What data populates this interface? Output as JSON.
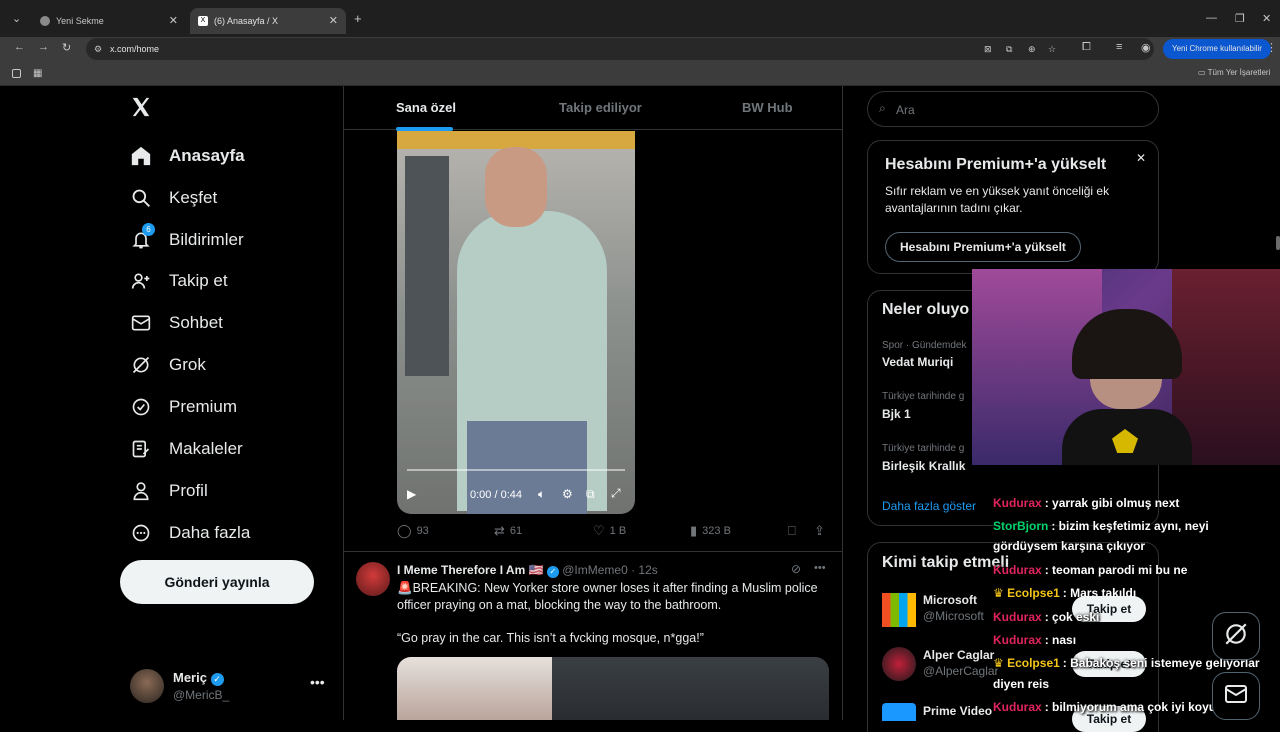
{
  "browser": {
    "tabs": [
      {
        "title": "Yeni Sekme"
      },
      {
        "title": "(6) Anasayfa / X"
      }
    ],
    "url": "x.com/home",
    "update_badge": "Yeni Chrome kullanılabilir",
    "bookmarks_all": "Tüm Yer İşaretleri"
  },
  "sidebar": {
    "items": [
      {
        "label": "Anasayfa",
        "icon": "home-icon"
      },
      {
        "label": "Keşfet",
        "icon": "search-icon"
      },
      {
        "label": "Bildirimler",
        "icon": "bell-icon",
        "badge": "6"
      },
      {
        "label": "Takip et",
        "icon": "follow-icon"
      },
      {
        "label": "Sohbet",
        "icon": "mail-icon"
      },
      {
        "label": "Grok",
        "icon": "grok-icon"
      },
      {
        "label": "Premium",
        "icon": "premium-icon"
      },
      {
        "label": "Makaleler",
        "icon": "articles-icon"
      },
      {
        "label": "Profil",
        "icon": "profile-icon"
      },
      {
        "label": "Daha fazla",
        "icon": "more-icon"
      }
    ],
    "post_button": "Gönderi yayınla",
    "account": {
      "name": "Meriç",
      "handle": "@MericB_"
    }
  },
  "feed": {
    "tabs": [
      "Sana özel",
      "Takip ediliyor",
      "BW Hub"
    ],
    "video": {
      "time": "0:00 / 0:44"
    },
    "stats": {
      "replies": "93",
      "reposts": "61",
      "likes": "1 B",
      "views": "323 B"
    },
    "post": {
      "author": "I Meme Therefore I Am 🇺🇸",
      "handle": "@ImMeme0",
      "time": "· 12s",
      "text": "🚨BREAKING: New Yorker store owner loses it after finding a Muslim police officer praying on a mat, blocking the way to the bathroom.",
      "quote": "“Go pray in the car. This isn’t a fvcking mosque, n*gga!”"
    }
  },
  "right": {
    "search_placeholder": "Ara",
    "premium": {
      "title": "Hesabını Premium+'a yükselt",
      "body": "Sıfır reklam ve en yüksek yanıt önceliği ek avantajlarının tadını çıkar.",
      "button": "Hesabını Premium+'a yükselt"
    },
    "trends": {
      "title": "Neler oluyo",
      "items": [
        {
          "sub": "Spor · Gündemdek",
          "main": "Vedat Muriqi"
        },
        {
          "sub": "Türkiye tarihinde g",
          "main": "Bjk 1"
        },
        {
          "sub": "Türkiye tarihinde g",
          "main": "Birleşik Krallık"
        }
      ],
      "more": "Daha fazla göster"
    },
    "who_to_follow": {
      "title": "Kimi takip etmeli",
      "accounts": [
        {
          "name": "Microsoft",
          "handle": "@Microsoft"
        },
        {
          "name": "Alper Caglar",
          "handle": "@AlperCaglar"
        },
        {
          "name": "Prime Video",
          "handle": ""
        }
      ],
      "follow_label": "Takip et"
    }
  },
  "stream_chat": [
    {
      "user": "Kudurax",
      "color": "#e0245e",
      "msg": ": yarrak gibi olmuş next"
    },
    {
      "user": "StorBjorn",
      "color": "#00d26a",
      "msg": ": bizim keşfetimiz aynı, neyi"
    },
    {
      "user": "",
      "color": "#ffffff",
      "msg": "gördüysem karşına çıkıyor"
    },
    {
      "user": "Kudurax",
      "color": "#e0245e",
      "msg": ": teoman parodi mi bu ne"
    },
    {
      "user": "Ecolpse1",
      "color": "#f5c518",
      "msg": ": Mars takıldı"
    },
    {
      "user": "Kudurax",
      "color": "#e0245e",
      "msg": ": çok eski"
    },
    {
      "user": "Kudurax",
      "color": "#e0245e",
      "msg": ": nası"
    },
    {
      "user": "Ecolpse1",
      "color": "#f5c518",
      "msg": ": Babakoş seni istemeye geliyorlar"
    },
    {
      "user": "",
      "color": "#ffffff",
      "msg": "diyen reis"
    },
    {
      "user": "Kudurax",
      "color": "#e0245e",
      "msg": ": bilmiyorum ama çok iyi koyuyo"
    }
  ],
  "colors": {
    "accent": "#1d9bf0",
    "bg": "#000000",
    "border": "#2f3336",
    "muted": "#71767b"
  }
}
